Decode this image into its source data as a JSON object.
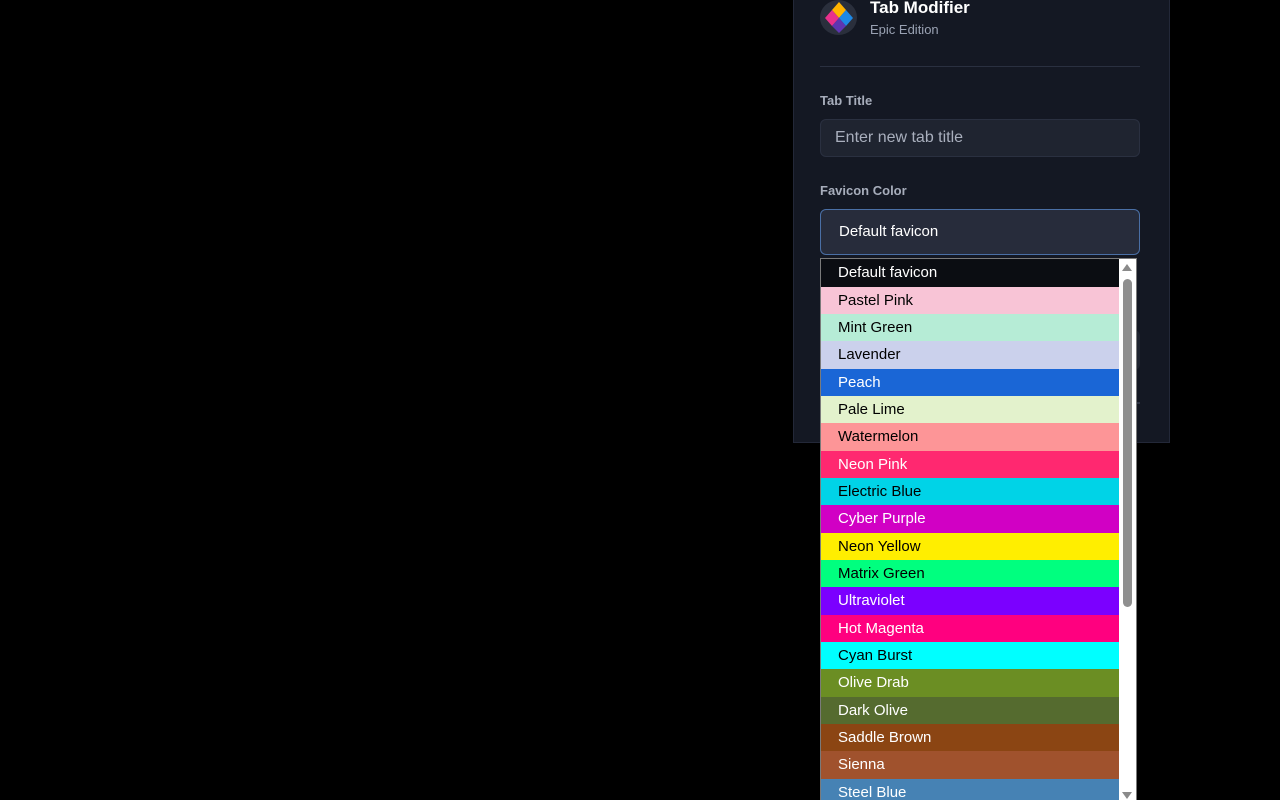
{
  "app": {
    "title": "Tab Modifier",
    "subtitle": "Epic Edition",
    "logo_icon": "tab-modifier-logo"
  },
  "form": {
    "tab_title_label": "Tab Title",
    "tab_title_placeholder": "Enter new tab title",
    "tab_title_value": "",
    "favicon_label": "Favicon Color",
    "favicon_selected": "Default favicon"
  },
  "favicon_options": [
    {
      "label": "Default favicon",
      "bg": "#0b0d12",
      "fg": "#ffffff"
    },
    {
      "label": "Pastel Pink",
      "bg": "#f8c4d6",
      "fg": "#000000"
    },
    {
      "label": "Mint Green",
      "bg": "#b6ecd6",
      "fg": "#000000"
    },
    {
      "label": "Lavender",
      "bg": "#cbd1ec",
      "fg": "#000000"
    },
    {
      "label": "Peach",
      "bg": "#1a66d6",
      "fg": "#ffffff"
    },
    {
      "label": "Pale Lime",
      "bg": "#e3f2cc",
      "fg": "#000000"
    },
    {
      "label": "Watermelon",
      "bg": "#fd9597",
      "fg": "#000000"
    },
    {
      "label": "Neon Pink",
      "bg": "#ff2870",
      "fg": "#ffffff"
    },
    {
      "label": "Electric Blue",
      "bg": "#00d3e7",
      "fg": "#000000"
    },
    {
      "label": "Cyber Purple",
      "bg": "#d100c4",
      "fg": "#ffffff"
    },
    {
      "label": "Neon Yellow",
      "bg": "#ffee00",
      "fg": "#000000"
    },
    {
      "label": "Matrix Green",
      "bg": "#00ff7f",
      "fg": "#000000"
    },
    {
      "label": "Ultraviolet",
      "bg": "#7b00ff",
      "fg": "#ffffff"
    },
    {
      "label": "Hot Magenta",
      "bg": "#ff007f",
      "fg": "#ffffff"
    },
    {
      "label": "Cyan Burst",
      "bg": "#00ffff",
      "fg": "#000000"
    },
    {
      "label": "Olive Drab",
      "bg": "#6b8e23",
      "fg": "#ffffff"
    },
    {
      "label": "Dark Olive",
      "bg": "#556b2f",
      "fg": "#ffffff"
    },
    {
      "label": "Saddle Brown",
      "bg": "#8b4513",
      "fg": "#ffffff"
    },
    {
      "label": "Sienna",
      "bg": "#a0522d",
      "fg": "#ffffff"
    },
    {
      "label": "Steel Blue",
      "bg": "#4682b4",
      "fg": "#ffffff"
    }
  ]
}
